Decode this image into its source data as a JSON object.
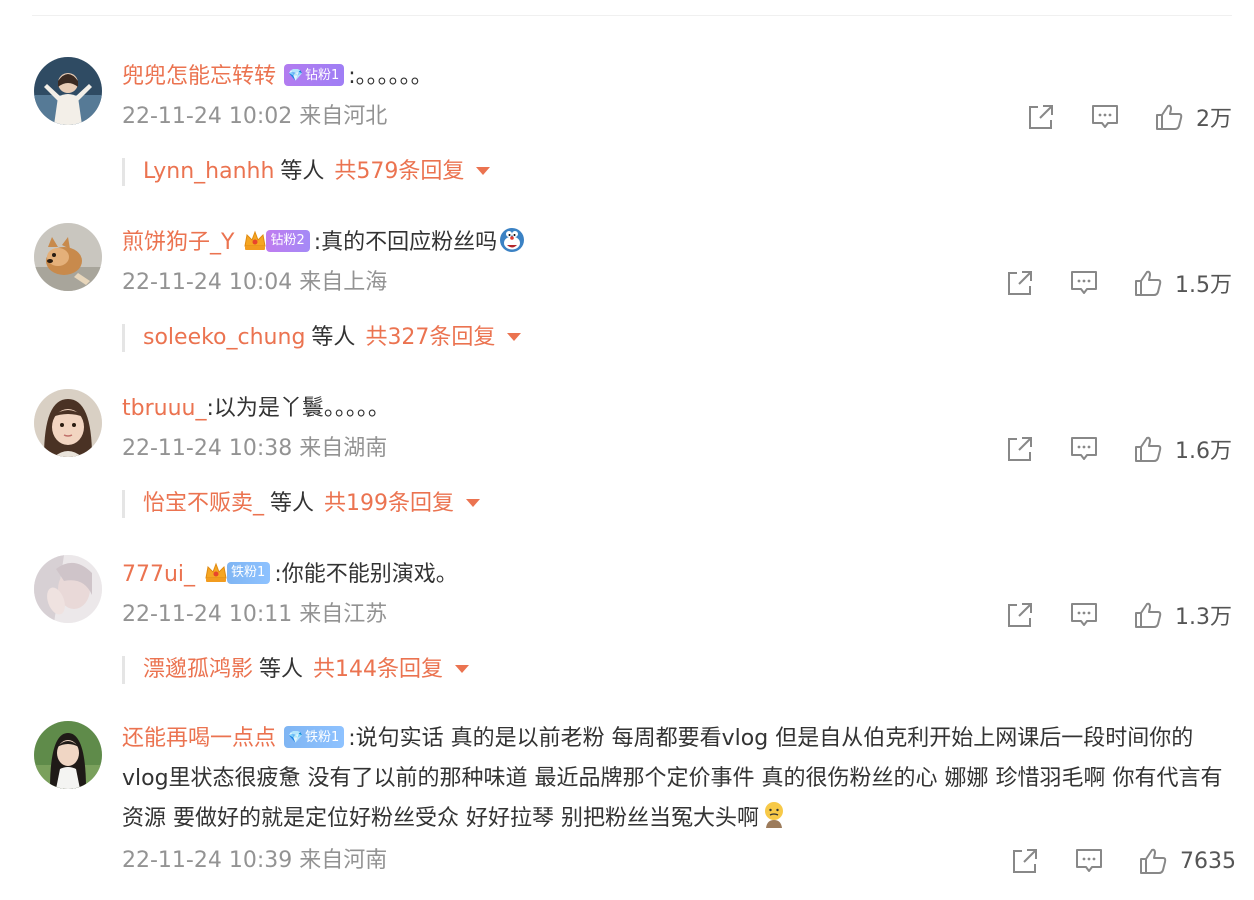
{
  "comments": [
    {
      "username": "兜兜怎能忘转转",
      "badge": "钻粉1",
      "text": ":。。。。。。",
      "meta": "22-11-24 10:02 来自河北",
      "likes": "2万",
      "replies": {
        "who": "Lynn_hanhh",
        "etc": "等人",
        "count": "共579条回复"
      }
    },
    {
      "username": "煎饼狗子_Y",
      "badge": "钻粉2",
      "text": ":真的不回应粉丝吗",
      "meta": "22-11-24 10:04 来自上海",
      "likes": "1.5万",
      "replies": {
        "who": "soleeko_chung",
        "etc": "等人",
        "count": "共327条回复"
      }
    },
    {
      "username": "tbruuu_",
      "text": ":以为是丫鬟。。。。。",
      "meta": "22-11-24 10:38 来自湖南",
      "likes": "1.6万",
      "replies": {
        "who": "怡宝不贩卖_",
        "etc": "等人",
        "count": "共199条回复"
      }
    },
    {
      "username": "777ui_",
      "badge": "铁粉1",
      "text": ":你能不能别演戏。",
      "meta": "22-11-24 10:11 来自江苏",
      "likes": "1.3万",
      "replies": {
        "who": "漂邈孤鸿影",
        "etc": "等人",
        "count": "共144条回复"
      }
    },
    {
      "username": "还能再喝一点点",
      "badge": "铁粉1",
      "text": ":说句实话 真的是以前老粉 每周都要看vlog 但是自从伯克利开始上网课后一段时间你的vlog里状态很疲惫 没有了以前的那种味道 最近品牌那个定价事件 真的很伤粉丝的心 娜娜 珍惜羽毛啊 你有代言有资源 要做好的就是定位好粉丝受众 好好拉琴 别把粉丝当冤大头啊",
      "meta": "22-11-24 10:39 来自河南",
      "likes": "7635"
    }
  ],
  "colors": {
    "accent": "#eb7350",
    "meta": "#939393",
    "text": "#333333"
  },
  "icons": {
    "share": "share-icon",
    "reply": "comment-icon",
    "like": "thumbs-up-icon",
    "diamond": "diamond-icon",
    "crown": "crown-icon",
    "emoji": "emoji-icon"
  }
}
